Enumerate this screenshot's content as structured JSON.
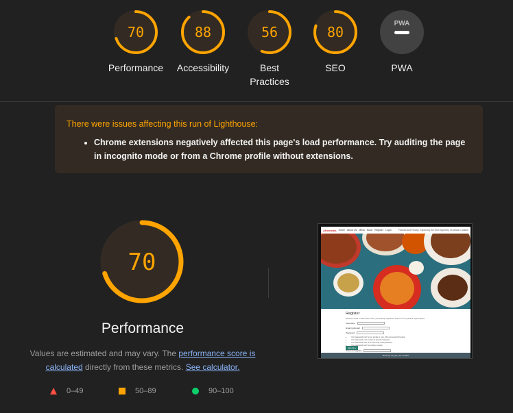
{
  "colors": {
    "average": "#ffa400",
    "average_bg": "#332b23",
    "fail": "#ff4e42",
    "pass": "#0cce6b",
    "link": "#8ab4f8"
  },
  "categories": [
    {
      "label": "Performance",
      "score": "70",
      "value": 70
    },
    {
      "label": "Accessibility",
      "score": "88",
      "value": 88
    },
    {
      "label": "Best\nPractices",
      "score": "56",
      "value": 56
    },
    {
      "label": "SEO",
      "score": "80",
      "value": 80
    }
  ],
  "pwa": {
    "label": "PWA",
    "badge_text": "PWA",
    "icon": "pwa-badge-icon"
  },
  "warning": {
    "title": "There were issues affecting this run of Lighthouse:",
    "items": [
      "Chrome extensions negatively affected this page's load performance. Try auditing the page in incognito mode or from a Chrome profile without extensions."
    ]
  },
  "performance": {
    "score": "70",
    "value": 70,
    "title": "Performance",
    "explain_prefix": "Values are estimated and may vary. The ",
    "link_score": "performance score is calculated",
    "explain_middle": " directly from these metrics. ",
    "link_calc": "See calculator."
  },
  "legend": [
    {
      "icon": "fail-triangle-icon",
      "range": "0–49"
    },
    {
      "icon": "average-square-icon",
      "range": "50–89"
    },
    {
      "icon": "pass-circle-icon",
      "range": "90–100"
    }
  ],
  "thumbnail": {
    "brand": "Afromeals",
    "nav": [
      "Home",
      "About Us",
      "Menu",
      "Book",
      "Register",
      "Login"
    ],
    "nav_right": "Flavors and Roots | Exploring the Rich Tapestry of African Cuisine",
    "form_title": "Register",
    "form_intro": "Welcome back to Afromeals. Have you already registered with us? Then please login instead.",
    "fields": [
      "Username",
      "Email (optional)",
      "Password"
    ],
    "rules": [
      "Your password can't be too similar to your other personal information.",
      "Your password must contain at least 8 characters.",
      "Your password can't be a commonly used password.",
      "Your password can't be entirely numeric."
    ],
    "field_again": "Password (again)",
    "button": "Sign Up »",
    "footer": "Made by Gregory De Guillich"
  }
}
